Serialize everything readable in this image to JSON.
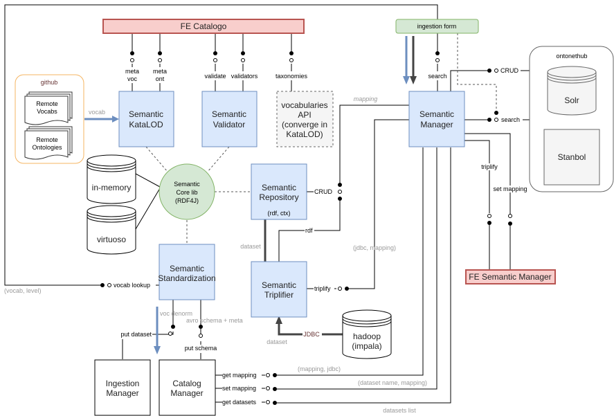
{
  "nodes": {
    "fe_catalogo": "FE Catalogo",
    "ingestion_form": "ingestion form",
    "github": "github",
    "remote_vocabs": [
      "Remote",
      "Vocabs"
    ],
    "remote_ontologies": [
      "Remote",
      "Ontologies"
    ],
    "semantic_katalod": [
      "Semantic",
      "KataLOD"
    ],
    "semantic_validator": [
      "Semantic",
      "Validator"
    ],
    "vocabularies_api": [
      "vocabularies",
      "API",
      "(converge in",
      "KataLOD)"
    ],
    "semantic_manager": [
      "Semantic",
      "Manager"
    ],
    "ontonethub": "ontonethub",
    "solr": "Solr",
    "stanbol": "Stanbol",
    "in_memory": "in-memory",
    "virtuoso": "virtuoso",
    "semantic_core_lib": [
      "Semantic",
      "Core lib",
      "(RDF4J)"
    ],
    "semantic_repository": [
      "Semantic",
      "Repository"
    ],
    "semantic_repository_sub": "(rdf, ctx)",
    "semantic_standardization": [
      "Semantic",
      "Standardization"
    ],
    "semantic_triplifier": [
      "Semantic",
      "Triplifier"
    ],
    "hadoop": [
      "hadoop",
      "(impala)"
    ],
    "fe_semantic_manager": "FE Semantic Manager",
    "ingestion_manager": [
      "Ingestion",
      "Manager"
    ],
    "catalog_manager": [
      "Catalog",
      "Manager"
    ]
  },
  "interfaces": {
    "meta_voc": [
      "meta",
      "voc"
    ],
    "meta_ont": [
      "meta",
      "ont"
    ],
    "validate": "validate",
    "validators": "validators",
    "taxonomies": "taxonomies",
    "search": "search",
    "crud_ontonethub": "CRUD",
    "search_ontonethub": "search",
    "crud_repository": "CRUD",
    "rdf": "rdf",
    "triplify_triplifier": "triplify",
    "triplify_manager": "triplify",
    "set_mapping_manager": "set mapping",
    "vocab_lookup": "vocab lookup",
    "put_dataset": "put dataset",
    "put_schema": "put schema",
    "get_mapping": "get mapping",
    "set_mapping": "set mapping",
    "get_datasets": "get datasets",
    "jdbc": "JDBC"
  },
  "flow_labels": {
    "vocab": "vocab",
    "mapping": "mapping",
    "dataset_repo": "dataset",
    "dataset_hadoop": "dataset",
    "jdbc_mapping": "(jdbc, mapping)",
    "vocab_level": "(vocab, level)",
    "voc_denorm": "voc denorm",
    "avro_schema_meta": "avro schema + meta",
    "mapping_jdbc": "(mapping, jdbc)",
    "dataset_name_mapping": "(dataset name, mapping)",
    "datasets_list": "datasets list"
  },
  "colors": {
    "blue_fill": "#dae8fc",
    "blue_stroke": "#6c8ebf",
    "red_fill": "#f8cecc",
    "red_stroke": "#b85450",
    "green_fill": "#d5e8d4",
    "green_stroke": "#82b366",
    "orange_stroke": "#f5b562",
    "grey_fill": "#f5f5f5",
    "arrow_blue": "#6c8ebf",
    "arrow_dark": "#444444"
  }
}
